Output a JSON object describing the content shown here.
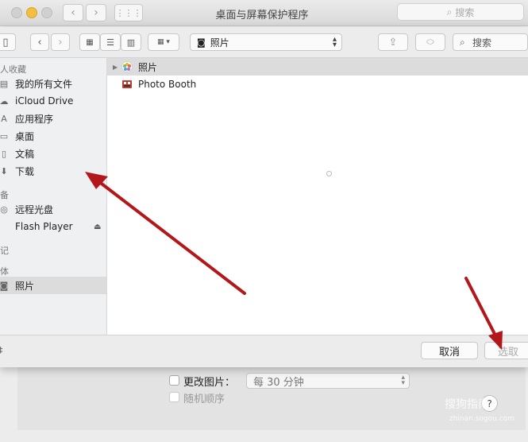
{
  "window": {
    "title": "桌面与屏幕保护程序",
    "search_placeholder": "搜索"
  },
  "dialog": {
    "toolbar": {
      "location": "照片",
      "search_placeholder": "搜索"
    },
    "sidebar": {
      "sections": [
        {
          "heading": "人收藏"
        },
        {
          "heading": "备"
        },
        {
          "heading": "记"
        },
        {
          "heading": "体"
        }
      ],
      "items": [
        {
          "label": "我的所有文件",
          "icon": "all-files-icon"
        },
        {
          "label": "iCloud Drive",
          "icon": "cloud-icon"
        },
        {
          "label": "应用程序",
          "icon": "applications-icon"
        },
        {
          "label": "桌面",
          "icon": "desktop-icon"
        },
        {
          "label": "文稿",
          "icon": "documents-icon"
        },
        {
          "label": "下载",
          "icon": "download-icon"
        },
        {
          "label": "远程光盘",
          "icon": "disc-icon"
        },
        {
          "label": "Flash Player",
          "icon": "drive-icon"
        },
        {
          "label": "照片",
          "icon": "camera-icon"
        }
      ]
    },
    "files": [
      {
        "label": "照片",
        "icon": "photos-icon"
      },
      {
        "label": "Photo Booth",
        "icon": "photobooth-icon"
      }
    ],
    "footer": {
      "left_fragment": "‡",
      "cancel": "取消",
      "choose": "选取"
    }
  },
  "settings": {
    "change_picture": "更改图片：",
    "interval": "每 30 分钟",
    "random_order": "随机顺序",
    "help": "?"
  },
  "watermark": {
    "text": "搜狗指南",
    "url": "zhinan.sogou.com"
  },
  "colors": {
    "annotation_arrow": "#b3171a",
    "selected_row": "#dcdcdc",
    "sidebar_bg": "#eef0f2"
  }
}
